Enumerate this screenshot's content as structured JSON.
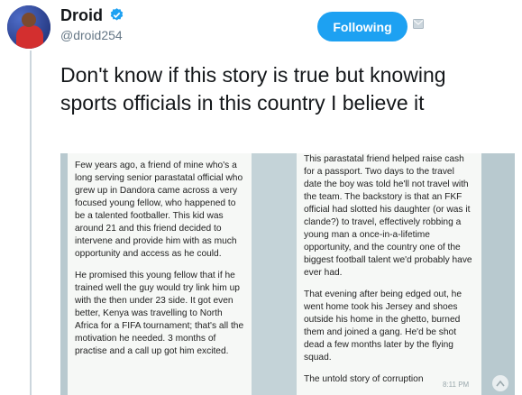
{
  "user": {
    "name": "Droid",
    "handle": "@droid254"
  },
  "follow_button": {
    "label": "Following"
  },
  "tweet": {
    "text": "Don't know if this story is true but knowing sports officials in this country I believe it"
  },
  "media": {
    "left_paragraphs": [
      "Few years ago, a friend of mine who's a long serving senior parastatal official who grew up in Dandora came across a very focused young fellow, who happened to be a talented footballer. This kid was around 21 and this friend decided to intervene and provide him with as much opportunity and access as he could.",
      "He promised this young fellow that if he trained well the guy would try link him up with the then under 23 side. It got even better, Kenya was travelling to North Africa for a FIFA tournament; that's all the motivation he needed. 3 months of practise and a call up got him excited."
    ],
    "right_paragraphs": [
      "This parastatal friend helped raise cash for a passport. Two days to the travel date the boy was told he'll not travel with the team. The backstory is that an FKF official had slotted his daughter (or was it clande?) to travel, effectively robbing a young man a once-in-a-lifetime opportunity, and the country one of the biggest football talent we'd probably have ever had.",
      "That evening after being edged out, he went home took his Jersey and shoes outside his home in the ghetto, burned them and joined a gang. He'd be shot dead a few months later by the flying squad.",
      "The untold story of corruption"
    ],
    "timestamp": "8:11 PM"
  },
  "icons": {
    "verified": "verified-badge-icon",
    "dm": "direct-message-icon",
    "expand": "expand-icon"
  },
  "colors": {
    "accent": "#1da1f2",
    "text": "#14171a",
    "muted": "#657786"
  }
}
